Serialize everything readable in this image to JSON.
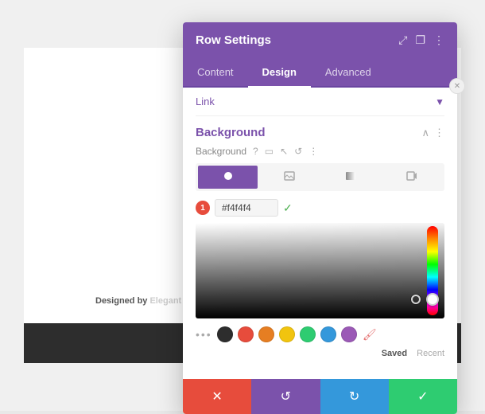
{
  "page": {
    "bg_text_designed": "Designed by",
    "bg_text_brand": "Elegant Themes"
  },
  "panel": {
    "title": "Row Settings",
    "tabs": [
      {
        "id": "content",
        "label": "Content",
        "active": false
      },
      {
        "id": "design",
        "label": "Design",
        "active": true
      },
      {
        "id": "advanced",
        "label": "Advanced",
        "active": false
      }
    ],
    "link_label": "Link",
    "background_section": {
      "title": "Background",
      "label": "Background",
      "hex_value": "#f4f4f4"
    },
    "swatches": [
      {
        "color": "#2d2d2d",
        "name": "black"
      },
      {
        "color": "#e74c3c",
        "name": "red"
      },
      {
        "color": "#e67e22",
        "name": "orange"
      },
      {
        "color": "#f1c40f",
        "name": "yellow"
      },
      {
        "color": "#2ecc71",
        "name": "green"
      },
      {
        "color": "#3498db",
        "name": "blue"
      },
      {
        "color": "#9b59b6",
        "name": "purple"
      }
    ],
    "saved_label": "Saved",
    "recent_label": "Recent",
    "actions": {
      "cancel_label": "✕",
      "undo_label": "↺",
      "redo_label": "↻",
      "confirm_label": "✓"
    },
    "badge_number": "1"
  }
}
